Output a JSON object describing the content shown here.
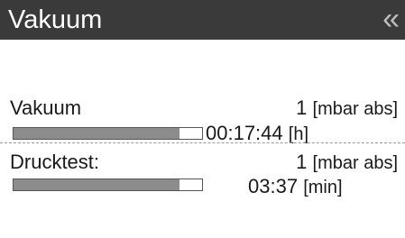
{
  "header": {
    "title": "Vakuum",
    "collapse_icon": "double-chevron-left-icon",
    "collapse_glyph": "«"
  },
  "vacuum": {
    "label": "Vakuum",
    "value": "1",
    "unit": "[mbar abs]",
    "progress_fraction": 0.88,
    "time": "00:17:44",
    "time_unit": "[h]"
  },
  "pressure_test": {
    "label": "Drucktest:",
    "value": "1",
    "unit": "[mbar abs]",
    "progress_fraction": 0.88,
    "time": "03:37",
    "time_unit": "[min]"
  },
  "colors": {
    "header_bg": "#3a3a3a",
    "bar_fill": "#8c8c8c"
  }
}
